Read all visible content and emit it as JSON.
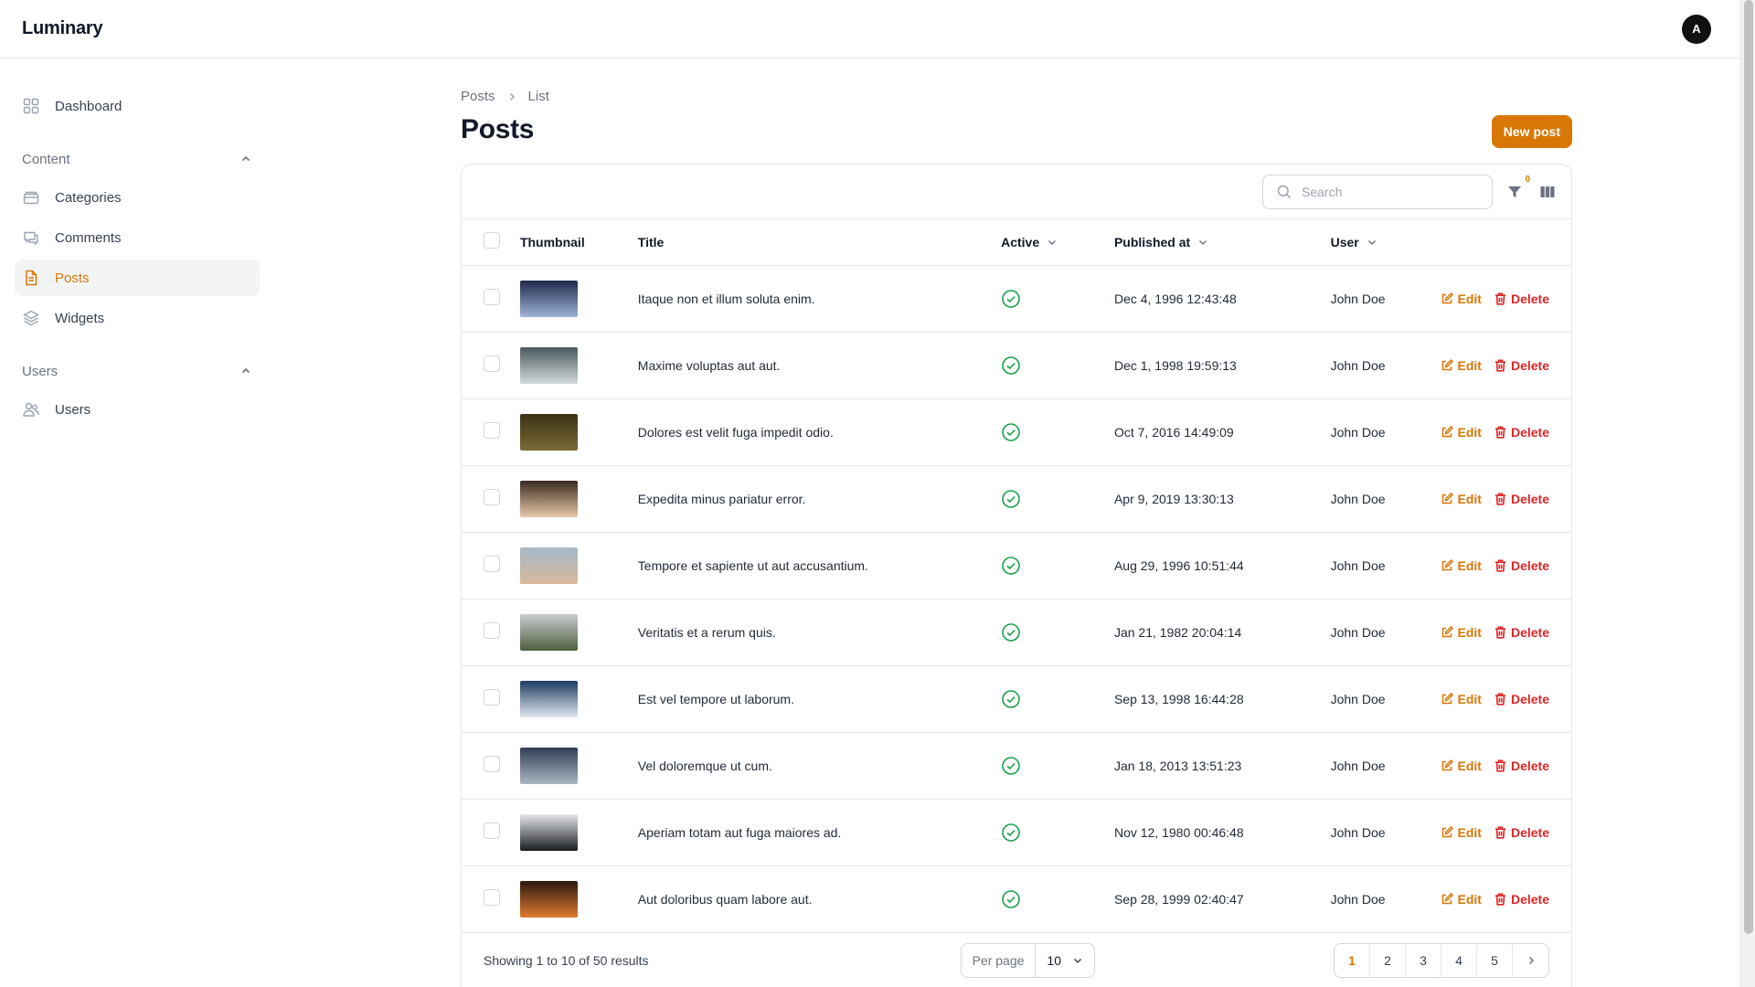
{
  "app": {
    "brand": "Luminary",
    "avatar_initial": "A"
  },
  "sidebar": {
    "dashboard": {
      "label": "Dashboard",
      "icon": "grid-icon"
    },
    "groups": [
      {
        "label": "Content",
        "items": [
          {
            "label": "Categories",
            "icon": "folder-icon"
          },
          {
            "label": "Comments",
            "icon": "chat-icon"
          },
          {
            "label": "Posts",
            "icon": "document-icon",
            "active": true
          },
          {
            "label": "Widgets",
            "icon": "layers-icon"
          }
        ]
      },
      {
        "label": "Users",
        "items": [
          {
            "label": "Users",
            "icon": "users-icon"
          }
        ]
      }
    ]
  },
  "breadcrumb": {
    "parent": "Posts",
    "current": "List"
  },
  "page": {
    "title": "Posts",
    "new_button": "New post"
  },
  "toolbar": {
    "search_placeholder": "Search",
    "filter_count": "0"
  },
  "table": {
    "headers": {
      "thumbnail": "Thumbnail",
      "title": "Title",
      "active": "Active",
      "published_at": "Published at",
      "user": "User"
    },
    "actions": {
      "edit": "Edit",
      "delete": "Delete"
    },
    "rows": [
      {
        "title": "Itaque non et illum soluta enim.",
        "active": true,
        "published_at": "Dec 4, 1996 12:43:48",
        "user": "John Doe",
        "thumb_colors": [
          "#1e2a4a",
          "#9fb4d8"
        ]
      },
      {
        "title": "Maxime voluptas aut aut.",
        "active": true,
        "published_at": "Dec 1, 1998 19:59:13",
        "user": "John Doe",
        "thumb_colors": [
          "#4b5a5e",
          "#d3dadb"
        ]
      },
      {
        "title": "Dolores est velit fuga impedit odio.",
        "active": true,
        "published_at": "Oct 7, 2016 14:49:09",
        "user": "John Doe",
        "thumb_colors": [
          "#3b3216",
          "#7a6a35"
        ]
      },
      {
        "title": "Expedita minus pariatur error.",
        "active": true,
        "published_at": "Apr 9, 2019 13:30:13",
        "user": "John Doe",
        "thumb_colors": [
          "#3a2a22",
          "#e8c9a8"
        ]
      },
      {
        "title": "Tempore et sapiente ut aut accusantium.",
        "active": true,
        "published_at": "Aug 29, 1996 10:51:44",
        "user": "John Doe",
        "thumb_colors": [
          "#a7b9c9",
          "#d8b89a"
        ]
      },
      {
        "title": "Veritatis et a rerum quis.",
        "active": true,
        "published_at": "Jan 21, 1982 20:04:14",
        "user": "John Doe",
        "thumb_colors": [
          "#c9ccd2",
          "#4f5f3d"
        ]
      },
      {
        "title": "Est vel tempore ut laborum.",
        "active": true,
        "published_at": "Sep 13, 1998 16:44:28",
        "user": "John Doe",
        "thumb_colors": [
          "#1d3c62",
          "#dfe7ef"
        ]
      },
      {
        "title": "Vel doloremque ut cum.",
        "active": true,
        "published_at": "Jan 18, 2013 13:51:23",
        "user": "John Doe",
        "thumb_colors": [
          "#2f3f55",
          "#aab6c3"
        ]
      },
      {
        "title": "Aperiam totam aut fuga maiores ad.",
        "active": true,
        "published_at": "Nov 12, 1980 00:46:48",
        "user": "John Doe",
        "thumb_colors": [
          "#e5e7ea",
          "#1a1d1f"
        ]
      },
      {
        "title": "Aut doloribus quam labore aut.",
        "active": true,
        "published_at": "Sep 28, 1999 02:40:47",
        "user": "John Doe",
        "thumb_colors": [
          "#2a1a10",
          "#e07b2e"
        ]
      }
    ]
  },
  "footer": {
    "showing": "Showing 1 to 10 of 50 results",
    "per_page_label": "Per page",
    "per_page_value": "10",
    "pages": [
      "1",
      "2",
      "3",
      "4",
      "5"
    ],
    "current_page": "1"
  },
  "colors": {
    "accent": "#d97706",
    "danger": "#dc2626",
    "success": "#16a34a"
  }
}
